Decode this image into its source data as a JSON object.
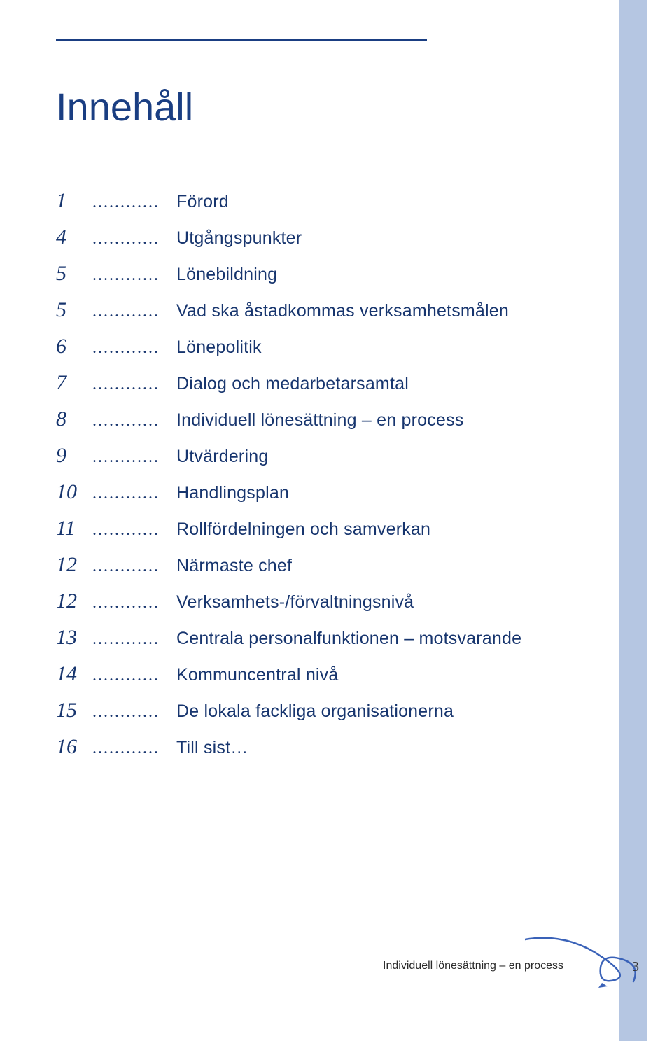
{
  "title": "Innehåll",
  "toc": [
    {
      "page": "1",
      "label": "Förord"
    },
    {
      "page": "4",
      "label": "Utgångspunkter"
    },
    {
      "page": "5",
      "label": "Lönebildning"
    },
    {
      "page": "5",
      "label": "Vad ska åstadkommas verksamhetsmålen"
    },
    {
      "page": "6",
      "label": "Lönepolitik"
    },
    {
      "page": "7",
      "label": "Dialog och medarbetarsamtal"
    },
    {
      "page": "8",
      "label": "Individuell lönesättning – en process"
    },
    {
      "page": "9",
      "label": "Utvärdering"
    },
    {
      "page": "10",
      "label": "Handlingsplan"
    },
    {
      "page": "11",
      "label": "Rollfördelningen och samverkan"
    },
    {
      "page": "12",
      "label": "Närmaste chef"
    },
    {
      "page": "12",
      "label": "Verksamhets-/förvaltningsnivå"
    },
    {
      "page": "13",
      "label": "Centrala personalfunktionen – motsvarande"
    },
    {
      "page": "14",
      "label": "Kommuncentral nivå"
    },
    {
      "page": "15",
      "label": "De lokala fackliga organisationerna"
    },
    {
      "page": "16",
      "label": "Till sist…"
    }
  ],
  "footer": {
    "text": "Individuell lönesättning – en process",
    "page_number": "3"
  },
  "dots": "............"
}
